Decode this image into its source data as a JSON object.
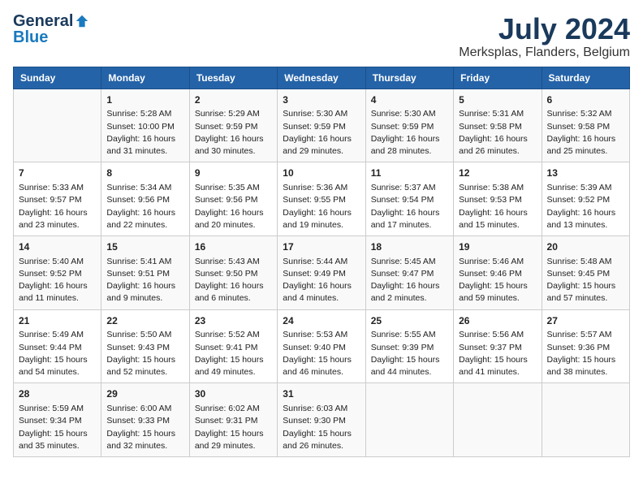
{
  "header": {
    "logo_general": "General",
    "logo_blue": "Blue",
    "month": "July 2024",
    "location": "Merksplas, Flanders, Belgium"
  },
  "days_of_week": [
    "Sunday",
    "Monday",
    "Tuesday",
    "Wednesday",
    "Thursday",
    "Friday",
    "Saturday"
  ],
  "weeks": [
    [
      {
        "day": "",
        "info": ""
      },
      {
        "day": "1",
        "info": "Sunrise: 5:28 AM\nSunset: 10:00 PM\nDaylight: 16 hours\nand 31 minutes."
      },
      {
        "day": "2",
        "info": "Sunrise: 5:29 AM\nSunset: 9:59 PM\nDaylight: 16 hours\nand 30 minutes."
      },
      {
        "day": "3",
        "info": "Sunrise: 5:30 AM\nSunset: 9:59 PM\nDaylight: 16 hours\nand 29 minutes."
      },
      {
        "day": "4",
        "info": "Sunrise: 5:30 AM\nSunset: 9:59 PM\nDaylight: 16 hours\nand 28 minutes."
      },
      {
        "day": "5",
        "info": "Sunrise: 5:31 AM\nSunset: 9:58 PM\nDaylight: 16 hours\nand 26 minutes."
      },
      {
        "day": "6",
        "info": "Sunrise: 5:32 AM\nSunset: 9:58 PM\nDaylight: 16 hours\nand 25 minutes."
      }
    ],
    [
      {
        "day": "7",
        "info": "Sunrise: 5:33 AM\nSunset: 9:57 PM\nDaylight: 16 hours\nand 23 minutes."
      },
      {
        "day": "8",
        "info": "Sunrise: 5:34 AM\nSunset: 9:56 PM\nDaylight: 16 hours\nand 22 minutes."
      },
      {
        "day": "9",
        "info": "Sunrise: 5:35 AM\nSunset: 9:56 PM\nDaylight: 16 hours\nand 20 minutes."
      },
      {
        "day": "10",
        "info": "Sunrise: 5:36 AM\nSunset: 9:55 PM\nDaylight: 16 hours\nand 19 minutes."
      },
      {
        "day": "11",
        "info": "Sunrise: 5:37 AM\nSunset: 9:54 PM\nDaylight: 16 hours\nand 17 minutes."
      },
      {
        "day": "12",
        "info": "Sunrise: 5:38 AM\nSunset: 9:53 PM\nDaylight: 16 hours\nand 15 minutes."
      },
      {
        "day": "13",
        "info": "Sunrise: 5:39 AM\nSunset: 9:52 PM\nDaylight: 16 hours\nand 13 minutes."
      }
    ],
    [
      {
        "day": "14",
        "info": "Sunrise: 5:40 AM\nSunset: 9:52 PM\nDaylight: 16 hours\nand 11 minutes."
      },
      {
        "day": "15",
        "info": "Sunrise: 5:41 AM\nSunset: 9:51 PM\nDaylight: 16 hours\nand 9 minutes."
      },
      {
        "day": "16",
        "info": "Sunrise: 5:43 AM\nSunset: 9:50 PM\nDaylight: 16 hours\nand 6 minutes."
      },
      {
        "day": "17",
        "info": "Sunrise: 5:44 AM\nSunset: 9:49 PM\nDaylight: 16 hours\nand 4 minutes."
      },
      {
        "day": "18",
        "info": "Sunrise: 5:45 AM\nSunset: 9:47 PM\nDaylight: 16 hours\nand 2 minutes."
      },
      {
        "day": "19",
        "info": "Sunrise: 5:46 AM\nSunset: 9:46 PM\nDaylight: 15 hours\nand 59 minutes."
      },
      {
        "day": "20",
        "info": "Sunrise: 5:48 AM\nSunset: 9:45 PM\nDaylight: 15 hours\nand 57 minutes."
      }
    ],
    [
      {
        "day": "21",
        "info": "Sunrise: 5:49 AM\nSunset: 9:44 PM\nDaylight: 15 hours\nand 54 minutes."
      },
      {
        "day": "22",
        "info": "Sunrise: 5:50 AM\nSunset: 9:43 PM\nDaylight: 15 hours\nand 52 minutes."
      },
      {
        "day": "23",
        "info": "Sunrise: 5:52 AM\nSunset: 9:41 PM\nDaylight: 15 hours\nand 49 minutes."
      },
      {
        "day": "24",
        "info": "Sunrise: 5:53 AM\nSunset: 9:40 PM\nDaylight: 15 hours\nand 46 minutes."
      },
      {
        "day": "25",
        "info": "Sunrise: 5:55 AM\nSunset: 9:39 PM\nDaylight: 15 hours\nand 44 minutes."
      },
      {
        "day": "26",
        "info": "Sunrise: 5:56 AM\nSunset: 9:37 PM\nDaylight: 15 hours\nand 41 minutes."
      },
      {
        "day": "27",
        "info": "Sunrise: 5:57 AM\nSunset: 9:36 PM\nDaylight: 15 hours\nand 38 minutes."
      }
    ],
    [
      {
        "day": "28",
        "info": "Sunrise: 5:59 AM\nSunset: 9:34 PM\nDaylight: 15 hours\nand 35 minutes."
      },
      {
        "day": "29",
        "info": "Sunrise: 6:00 AM\nSunset: 9:33 PM\nDaylight: 15 hours\nand 32 minutes."
      },
      {
        "day": "30",
        "info": "Sunrise: 6:02 AM\nSunset: 9:31 PM\nDaylight: 15 hours\nand 29 minutes."
      },
      {
        "day": "31",
        "info": "Sunrise: 6:03 AM\nSunset: 9:30 PM\nDaylight: 15 hours\nand 26 minutes."
      },
      {
        "day": "",
        "info": ""
      },
      {
        "day": "",
        "info": ""
      },
      {
        "day": "",
        "info": ""
      }
    ]
  ]
}
